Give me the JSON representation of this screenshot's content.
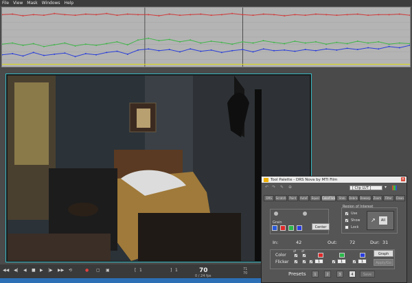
{
  "menu": [
    "File",
    "View",
    "Mask",
    "Windows",
    "Help"
  ],
  "colors": {
    "red_curve": "#d23a3a",
    "green_curve": "#3fb548",
    "blue_curve": "#2a3ed8",
    "yellow_line": "#d8d620",
    "selection_border": "#35b9c4",
    "timeline": "#2d6fb5"
  },
  "graph": {
    "red": [
      0.12,
      0.11,
      0.14,
      0.12,
      0.13,
      0.1,
      0.12,
      0.13,
      0.11,
      0.12,
      0.1,
      0.13,
      0.11,
      0.12,
      0.12,
      0.14,
      0.11,
      0.13,
      0.12,
      0.11,
      0.13,
      0.12,
      0.1,
      0.12,
      0.13,
      0.11,
      0.12,
      0.14,
      0.12,
      0.13,
      0.11,
      0.12,
      0.13,
      0.12,
      0.11,
      0.13,
      0.12,
      0.12,
      0.11,
      0.13
    ],
    "green": [
      0.62,
      0.6,
      0.64,
      0.61,
      0.66,
      0.63,
      0.6,
      0.65,
      0.62,
      0.64,
      0.61,
      0.58,
      0.63,
      0.55,
      0.52,
      0.56,
      0.54,
      0.58,
      0.55,
      0.6,
      0.57,
      0.59,
      0.62,
      0.58,
      0.6,
      0.56,
      0.59,
      0.61,
      0.57,
      0.6,
      0.58,
      0.62,
      0.59,
      0.61,
      0.57,
      0.6,
      0.58,
      0.62,
      0.6,
      0.61
    ],
    "blue": [
      0.8,
      0.78,
      0.82,
      0.76,
      0.81,
      0.79,
      0.77,
      0.83,
      0.78,
      0.8,
      0.76,
      0.74,
      0.79,
      0.72,
      0.7,
      0.73,
      0.71,
      0.75,
      0.7,
      0.74,
      0.72,
      0.76,
      0.73,
      0.71,
      0.75,
      0.7,
      0.73,
      0.72,
      0.74,
      0.71,
      0.73,
      0.7,
      0.72,
      0.69,
      0.71,
      0.68,
      0.7,
      0.66,
      0.68,
      0.64
    ],
    "yellow": 0.96,
    "markers": [
      0.35,
      0.59
    ]
  },
  "transport": {
    "frame": "70",
    "frame_sub": "0 / 24 fps",
    "right_a": "71",
    "right_b": "70",
    "left_marker": "1",
    "mid_marker": "1"
  },
  "palette": {
    "title": "Tool Palette - DRS Nova by MTI Film",
    "lut": "[ Clip LUT ]",
    "tabs": [
      "DRS",
      "Scratch",
      "Paint",
      "AutoF",
      "Equal",
      "ColorFlick",
      "Stab",
      "Debris",
      "Dewarp",
      "Zoom",
      "Filter",
      "Clean"
    ],
    "active_tab": 5,
    "grain": "Grain",
    "center": "Center",
    "roi": "Region of Interest",
    "use": "Use",
    "show": "Show",
    "lock": "Lock",
    "all": "All",
    "in_label": "In:",
    "in_val": "42",
    "out_label": "Out:",
    "out_val": "72",
    "dur_label": "Dur:",
    "dur_val": "31",
    "color": "Color",
    "flicker": "Flicker",
    "spin_a": "1",
    "spin_b": "1",
    "spin_c": "1",
    "graph_btn": "Graph",
    "apply_btn": "Apply/Go",
    "presets": "Presets",
    "preset_nums": [
      "1",
      "2",
      "3",
      "4"
    ],
    "preset_selected": 3,
    "preset_extra": "Save"
  }
}
